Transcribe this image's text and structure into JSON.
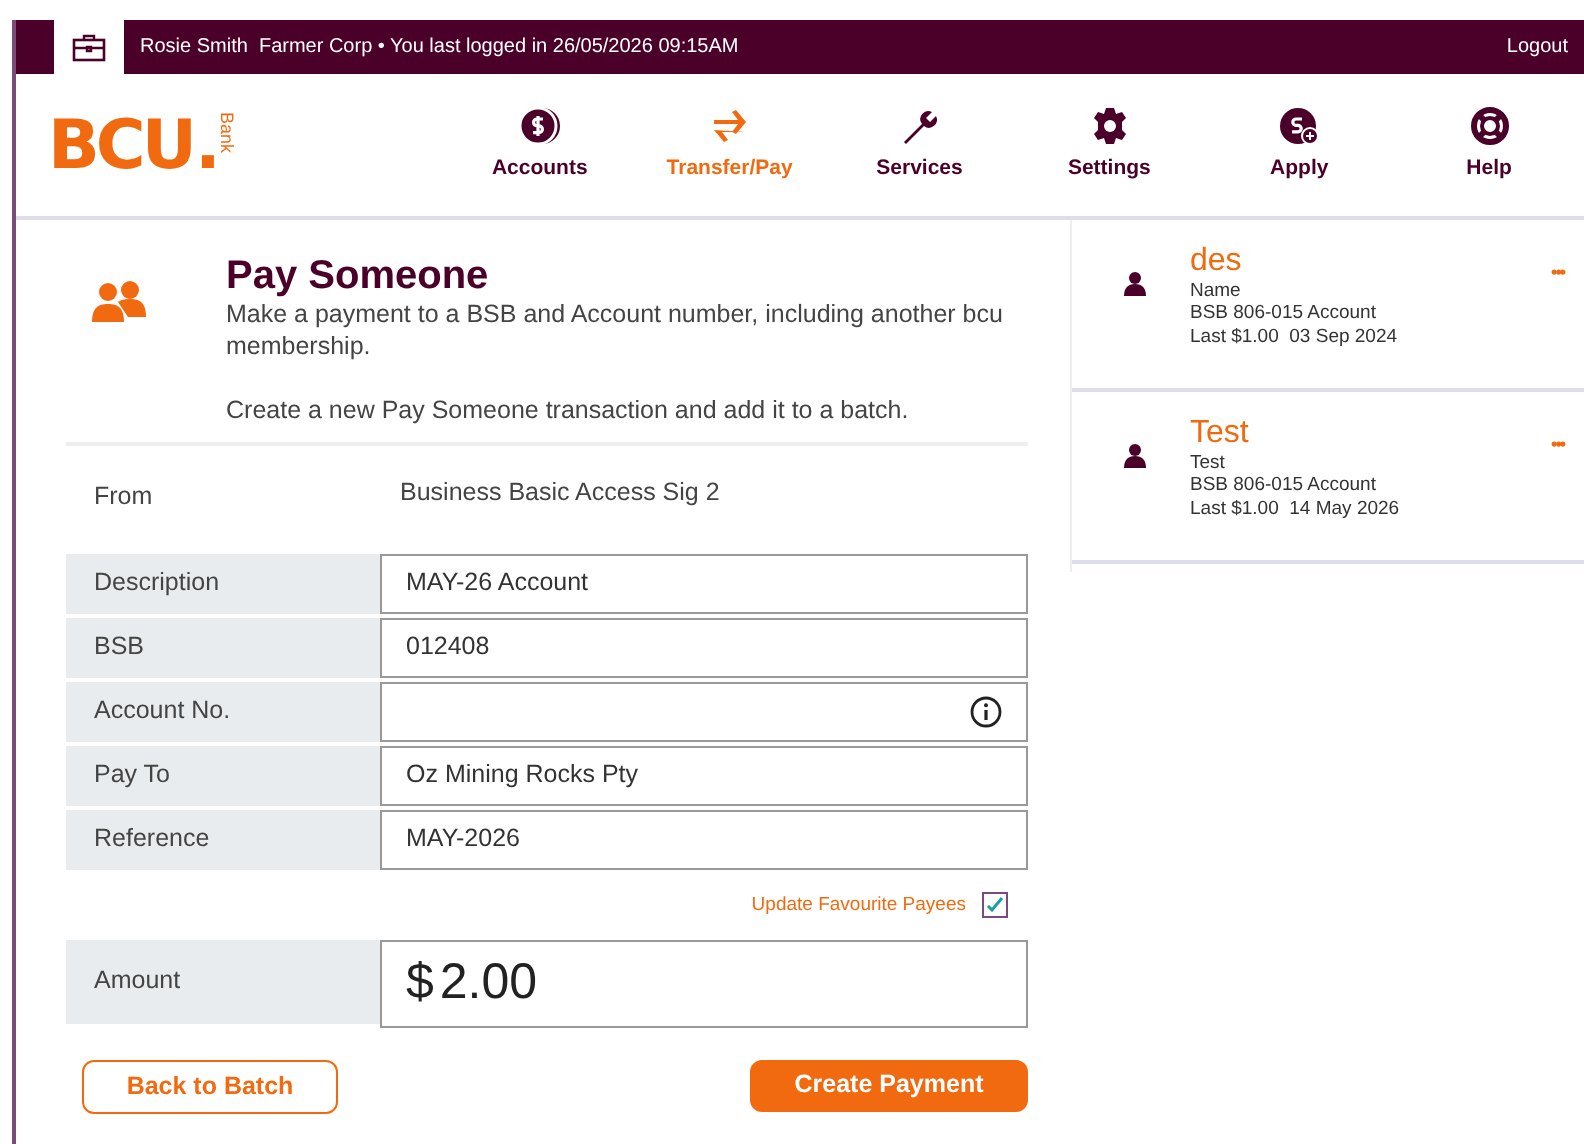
{
  "top_bar": {
    "user": "Rosie Smith",
    "org": "Farmer Corp",
    "separator": "•",
    "last_login": "You last logged in 26/05/2026 09:15AM",
    "logout": "Logout"
  },
  "logo": {
    "letters": "BCU",
    "dot": ".",
    "word": "Bank"
  },
  "nav": [
    {
      "label": "Accounts",
      "kind": "coin",
      "selected": false
    },
    {
      "label": "Transfer/Pay",
      "kind": "transfer",
      "selected": true
    },
    {
      "label": "Services",
      "kind": "tools",
      "selected": false
    },
    {
      "label": "Settings",
      "kind": "settings",
      "selected": false
    },
    {
      "label": "Apply",
      "kind": "apply",
      "selected": false
    },
    {
      "label": "Help",
      "kind": "help",
      "selected": false
    }
  ],
  "page": {
    "title": "Pay Someone",
    "description": "Make a payment to a BSB and Account number, including another bcu membership.",
    "note": "Create a new Pay Someone transaction and add it to a batch."
  },
  "from": {
    "label": "From",
    "value": "Business Basic Access Sig 2"
  },
  "fields": [
    {
      "label": "Description",
      "value": "MAY-26 Account"
    },
    {
      "label": "BSB",
      "value": "012408"
    },
    {
      "label": "Account No.",
      "info": true
    },
    {
      "label": "Pay To",
      "value": "Oz Mining Rocks Pty"
    },
    {
      "label": "Reference",
      "value": "MAY-2026"
    }
  ],
  "update_favourites": {
    "label": "Update Favourite Payees",
    "checked": true
  },
  "amount": {
    "label": "Amount",
    "currency": "$",
    "value": "2.00"
  },
  "buttons": {
    "back": "Back to Batch",
    "create": "Create Payment"
  },
  "payees": [
    {
      "name": "des",
      "detail": "Name",
      "bsb": "BSB 806-015 Account",
      "last": "Last $1.00  03 Sep 2024",
      "menu": "•••"
    },
    {
      "name": "Test",
      "detail": "Test",
      "bsb": "BSB 806-015 Account",
      "last": "Last $1.00  14 May 2026",
      "menu": "•••"
    }
  ]
}
